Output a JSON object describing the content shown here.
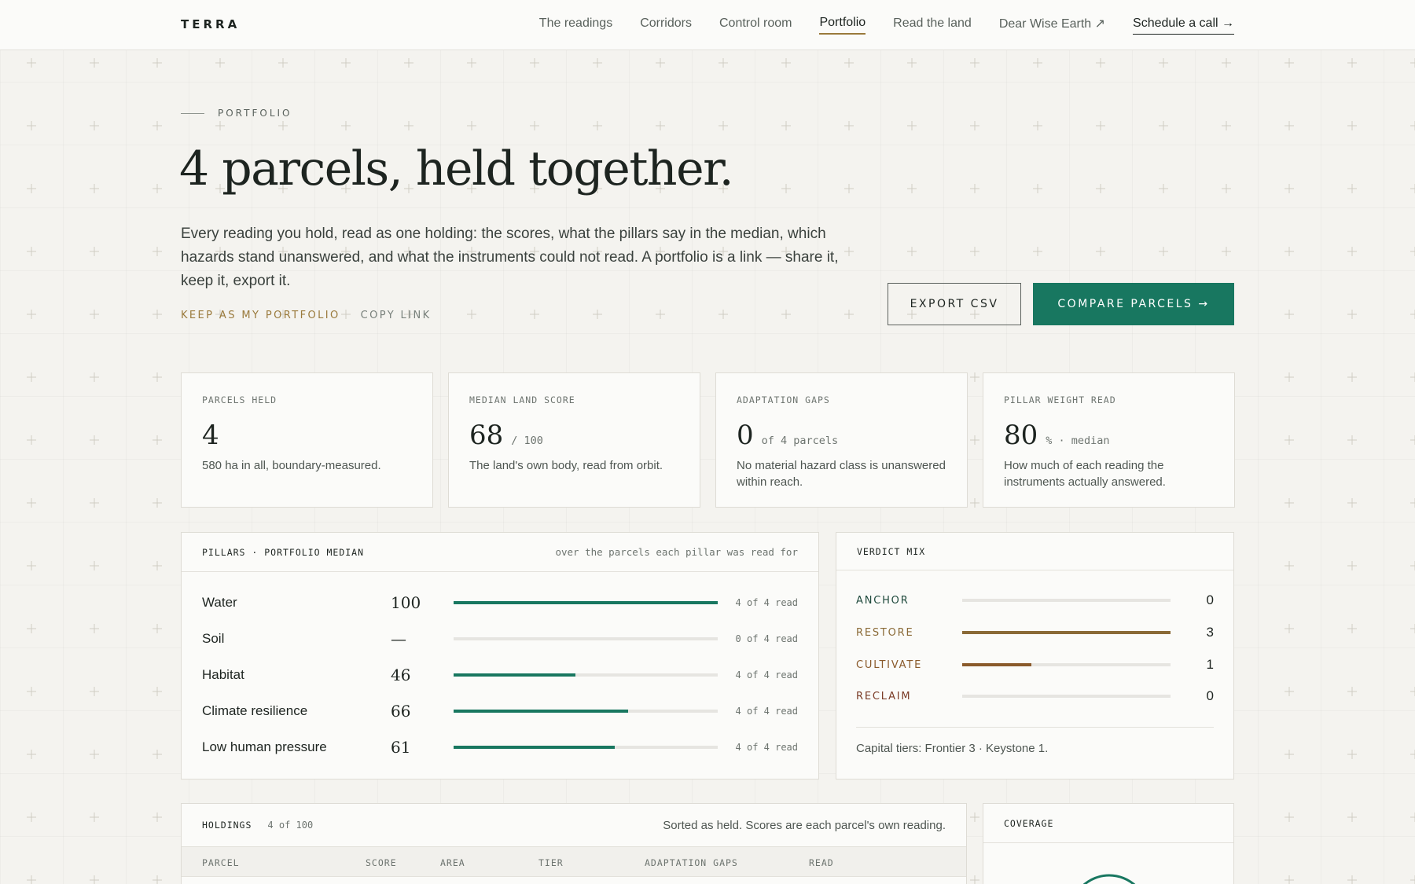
{
  "brand": "TERRA",
  "nav": {
    "items": [
      {
        "label": "The readings",
        "active": false
      },
      {
        "label": "Corridors",
        "active": false
      },
      {
        "label": "Control room",
        "active": false
      },
      {
        "label": "Portfolio",
        "active": true
      },
      {
        "label": "Read the land",
        "active": false
      },
      {
        "label": "Dear Wise Earth ↗",
        "active": false
      }
    ],
    "cta": "Schedule a call →"
  },
  "hero": {
    "eyebrow": "PORTFOLIO",
    "title": "4 parcels, held together.",
    "lede": "Every reading you hold, read as one holding: the scores, what the pillars say in the median, which hazards stand unanswered, and what the instruments could not read. A portfolio is a link — share it, keep it, export it.",
    "keep_link": "KEEP AS MY PORTFOLIO",
    "copy_link": "COPY LINK",
    "export_button": "EXPORT CSV",
    "compare_button": "COMPARE PARCELS →"
  },
  "stats": [
    {
      "label": "PARCELS HELD",
      "value": "4",
      "unit": "",
      "desc": "580 ha in all, boundary-measured."
    },
    {
      "label": "MEDIAN LAND SCORE",
      "value": "68",
      "unit": "/ 100",
      "desc": "The land's own body, read from orbit."
    },
    {
      "label": "ADAPTATION GAPS",
      "value": "0",
      "unit": "of 4 parcels",
      "desc": "No material hazard class is unanswered within reach."
    },
    {
      "label": "PILLAR WEIGHT READ",
      "value": "80",
      "unit": "% · median",
      "desc": "How much of each reading the instruments actually answered."
    }
  ],
  "pillars": {
    "title": "PILLARS · PORTFOLIO MEDIAN",
    "note": "over the parcels each pillar was read for",
    "rows": [
      {
        "name": "Water",
        "score": "100",
        "fill": 1.0,
        "read": "4 of 4 read"
      },
      {
        "name": "Soil",
        "score": "—",
        "fill": 0,
        "read": "0 of 4 read"
      },
      {
        "name": "Habitat",
        "score": "46",
        "fill": 0.46,
        "read": "4 of 4 read"
      },
      {
        "name": "Climate resilience",
        "score": "66",
        "fill": 0.66,
        "read": "4 of 4 read"
      },
      {
        "name": "Low human pressure",
        "score": "61",
        "fill": 0.61,
        "read": "4 of 4 read"
      }
    ]
  },
  "verdict": {
    "title": "VERDICT MIX",
    "rows": [
      {
        "name": "ANCHOR",
        "count": "0",
        "fill": 0,
        "color": "#1f4a3d"
      },
      {
        "name": "RESTORE",
        "count": "3",
        "fill": 1.0,
        "color": "#8a6a37"
      },
      {
        "name": "CULTIVATE",
        "count": "1",
        "fill": 0.333,
        "color": "#8a5a2b"
      },
      {
        "name": "RECLAIM",
        "count": "0",
        "fill": 0,
        "color": "#7a3b26"
      }
    ],
    "tiers": "Capital tiers: Frontier 3 · Keystone 1."
  },
  "holdings": {
    "title": "HOLDINGS",
    "count": "4 of 100",
    "note": "Sorted as held. Scores are each parcel's own reading.",
    "columns": [
      "PARCEL",
      "SCORE",
      "AREA",
      "TIER",
      "ADAPTATION GAPS",
      "READ"
    ]
  },
  "coverage": {
    "title": "COVERAGE"
  },
  "colors": {
    "accent": "#187760",
    "gold": "#9a7a3c"
  }
}
